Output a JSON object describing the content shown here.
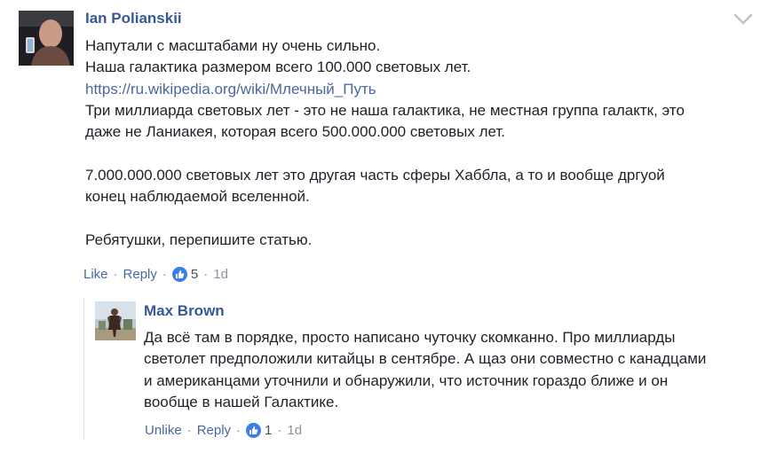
{
  "comment": {
    "author": "Ian Polianskii",
    "lines": [
      "Напутали с масштабами ну очень сильно.",
      "Наша галактика размером всего 100.000 световых лет."
    ],
    "link": "https://ru.wikipedia.org/wiki/Млечный_Путь",
    "lines_after": [
      "Три миллиарда световых лет - это не наша галактика, не местная группа галактк, это",
      "даже не Ланиакея, которая всего 500.000.000 световых лет."
    ],
    "paragraph2": [
      "7.000.000.000 световых лет это другая часть сферы Хаббла, а то и вообще дргуой",
      "конец наблюдаемой вселенной."
    ],
    "paragraph3": "Ребятушки, перепишите статью.",
    "actions": {
      "like": "Like",
      "reply": "Reply",
      "separator": "·",
      "reactions_count": "5",
      "time": "1d"
    }
  },
  "reply": {
    "author": "Max Brown",
    "lines": [
      "Да всё там в порядке, просто написано чуточку скомканно. Про миллиарды",
      "светолет предположили китайцы в сентябре. А щаз они совместно с канадцами",
      "и американцами уточнили и обнаружили, что источник гораздо ближе и он",
      "вообще в нашей Галактике."
    ],
    "actions": {
      "like": "Unlike",
      "reply": "Reply",
      "separator": "·",
      "reactions_count": "1",
      "time": "1d"
    }
  },
  "icons": {
    "menu": "chevron-down-icon",
    "reaction": "thumbs-up-icon"
  },
  "colors": {
    "link": "#4b67a1",
    "author": "#385898",
    "meta": "#8d949e",
    "like_badge": "#3b7ee8"
  }
}
